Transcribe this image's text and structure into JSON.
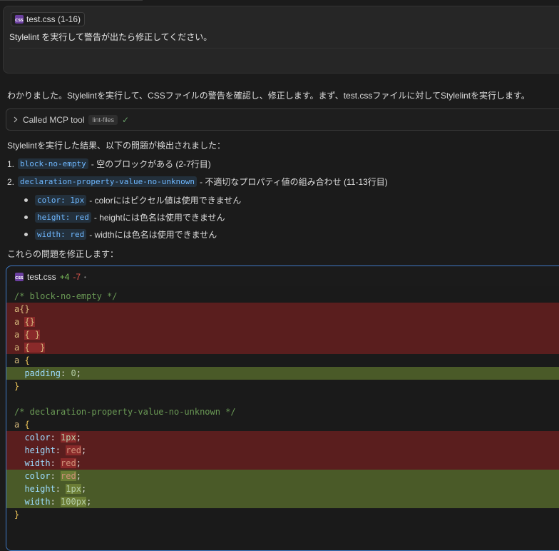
{
  "prompt": {
    "file_chip": "test.css (1-16)",
    "css_badge": "CSS",
    "text": "Stylelint を実行して警告が出たら修正してください。"
  },
  "response": {
    "intro": "わかりました。Stylelintを実行して、CSSファイルの警告を確認し、修正します。まず、test.cssファイルに対してStylelintを実行します。",
    "mcp": {
      "label": "Called MCP tool",
      "tag": "lint-files",
      "check": "✓"
    },
    "result_heading": "Stylelintを実行した結果、以下の問題が検出されました：",
    "items": [
      {
        "num": "1.",
        "code": "block-no-empty",
        "desc": "- 空のブロックがある (2-7行目)"
      },
      {
        "num": "2.",
        "code": "declaration-property-value-no-unknown",
        "desc": "- 不適切なプロパティ値の組み合わせ (11-13行目)"
      }
    ],
    "bullets": [
      {
        "code": "color: 1px",
        "desc": "- colorにはピクセル値は使用できません"
      },
      {
        "code": "height: red",
        "desc": "- heightには色名は使用できません"
      },
      {
        "code": "width: red",
        "desc": "- widthには色名は使用できません"
      }
    ],
    "fix_heading": "これらの問題を修正します："
  },
  "editor": {
    "filename": "test.css",
    "added": "+4",
    "removed": "-7",
    "dot": "•"
  },
  "code": {
    "c1": "/* block-no-empty */",
    "d1": "a{}",
    "d2a": "a ",
    "d2b": "{}",
    "d3a": "a ",
    "d3b": "{ }",
    "d4a": "a ",
    "d4b": "{  }",
    "k1a": "a ",
    "k1b": "{",
    "p1a": "  padding",
    "p1b": ": ",
    "p1c": "0",
    "p1d": ";",
    "k2": "}",
    "c2": "/* declaration-property-value-no-unknown */",
    "k3a": "a ",
    "k3b": "{",
    "r1a": "  color",
    "r1b": ": ",
    "r1c": "1px",
    "r1d": ";",
    "r2a": "  height",
    "r2b": ": ",
    "r2c": "red",
    "r2d": ";",
    "r3a": "  width",
    "r3b": ": ",
    "r3c": "red",
    "r3d": ";",
    "a1a": "  color",
    "a1b": ": ",
    "a1c": "red",
    "a1d": ";",
    "a2a": "  height",
    "a2b": ": ",
    "a2c": "1px",
    "a2d": ";",
    "a3a": "  width",
    "a3b": ": ",
    "a3c": "100px",
    "a3d": ";",
    "k4": "}"
  }
}
